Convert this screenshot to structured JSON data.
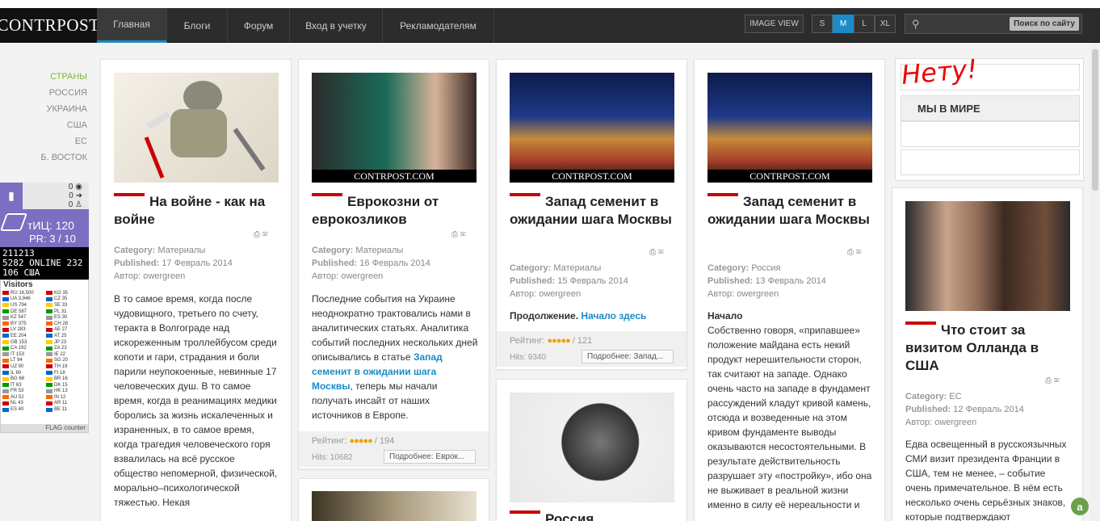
{
  "logo": {
    "text": "CONTRPOST"
  },
  "nav": {
    "items": [
      "Главная",
      "Блоги",
      "Форум",
      "Вход в учетку",
      "Рекламодателям"
    ],
    "image_view": "IMAGE VIEW",
    "sizes": [
      "S",
      "M",
      "L",
      "XL"
    ],
    "search_button": "Поиск по сайту",
    "accent": "#1b8cc7"
  },
  "sidebar": {
    "items": [
      "СТРАНЫ",
      "РОССИЯ",
      "УКРАИНА",
      "США",
      "ЕС",
      "Б. ВОСТОК"
    ],
    "stats": {
      "v1": "0",
      "v2": "0",
      "v3": "0"
    },
    "tic": "тИЦ: 120",
    "pr": "PR: 3 / 10",
    "online": [
      "211213",
      "5282 ONLINE 232",
      "106 США"
    ],
    "visitors_title": "Visitors",
    "flags_left": [
      "RU 16,500",
      "UA 3,946",
      "US 794",
      "DE 587",
      "KZ 547",
      "BY 375",
      "LV 283",
      "EE 204",
      "GB 153",
      "CA 192",
      "IT 153",
      "LT 94",
      "UZ 90",
      "IL 80",
      "BG 68",
      "IT 63",
      "FR 53",
      "AU 52",
      "NL 43",
      "ES 40"
    ],
    "flags_right": [
      "KG 35",
      "CZ 35",
      "SE 33",
      "PL 31",
      "ES 30",
      "CH 28",
      "AE 27",
      "AT 25",
      "JP 23",
      "ZA 23",
      "IE 22",
      "SG 20",
      "TH 19",
      "FI 18",
      "BR 16",
      "DK 15",
      "HK 13",
      "IN 12",
      "AR 11",
      "BE 11"
    ],
    "flag_counter": "FLAG counter"
  },
  "cards": [
    {
      "title": "На войне - как на войне",
      "category": "Материалы",
      "published": "17 Февраль 2014",
      "author": "owergreen",
      "body": "В то самое время, когда после чудовищного, третьего по счету, теракта в Волгограде над искореженным троллейбусом среди копоти и гари, страдания и боли парили неупокоенные, невинные 17 человеческих душ. В то самое время, когда в реанимациях медики боролись за жизнь искалеченных и израненных, в то самое время, когда трагедия человеческого горя взвалилась на всё русское общество непомерной, физической, морально–психологической тяжестью. Некая"
    },
    {
      "title": "Еврокозни от еврокозликов",
      "category": "Материалы",
      "published": "16 Февраль 2014",
      "author": "owergreen",
      "body_pre": "Последние события на Украине неоднократно трактовались нами в аналитических статьях. Аналитика событий последних нескольких дней описывались в статье ",
      "body_link": "Запад семенит в ожидании шага Москвы",
      "body_post": ", теперь мы начали получать инсайт от наших источников в Европе.",
      "rating_label": "Рейтинг:",
      "rating_count": "/ 194",
      "hits": "10682",
      "more": "Подробнее: Еврок..."
    },
    {
      "title": "Запад семенит в ожидании шага Москвы",
      "category": "Материалы",
      "published": "15 Февраль 2014",
      "author": "owergreen",
      "cont_label": "Продолжение.",
      "cont_link": "Начало здесь",
      "rating_label": "Рейтинг:",
      "rating_count": "/ 121",
      "hits": "9340",
      "more": "Подробнее: Запад..."
    },
    {
      "title": "Запад семенит в ожидании шага Москвы",
      "category": "Россия",
      "published": "13 Февраль 2014",
      "author": "owergreen",
      "body_head": "Начало",
      "body": "Собственно говоря, «припавшее» положение майдана есть некий продукт нерешительности сторон, так считают на западе. Однако очень часто на западе в фундамент рассуждений кладут кривой камень, отсюда и возведенные на этом кривом фундаменте выводы оказываются несостоятельными. В результате действительность разрушает эту «постройку», ибо она не выживает в реальной жизни именно в силу её нереальности и"
    },
    {
      "title": "Что стоит за визитом Олланда в США",
      "category": "ЕС",
      "published": "12 Февраль 2014",
      "author": "owergreen",
      "body": "Едва освещенный в русскоязычных СМИ визит президента Франции в США, тем не менее, – событие очень примечательное. В нём есть несколько очень серьёзных знаков, которые подтверждают"
    },
    {
      "title": "Россия"
    }
  ],
  "labels": {
    "category": "Category:",
    "published": "Published:",
    "author": "Автор:",
    "hits": "Hits:",
    "watermark": "CONTRPOST.COM"
  },
  "right_widget": {
    "title": "МЫ В МИРЕ",
    "note": "Нету!"
  }
}
